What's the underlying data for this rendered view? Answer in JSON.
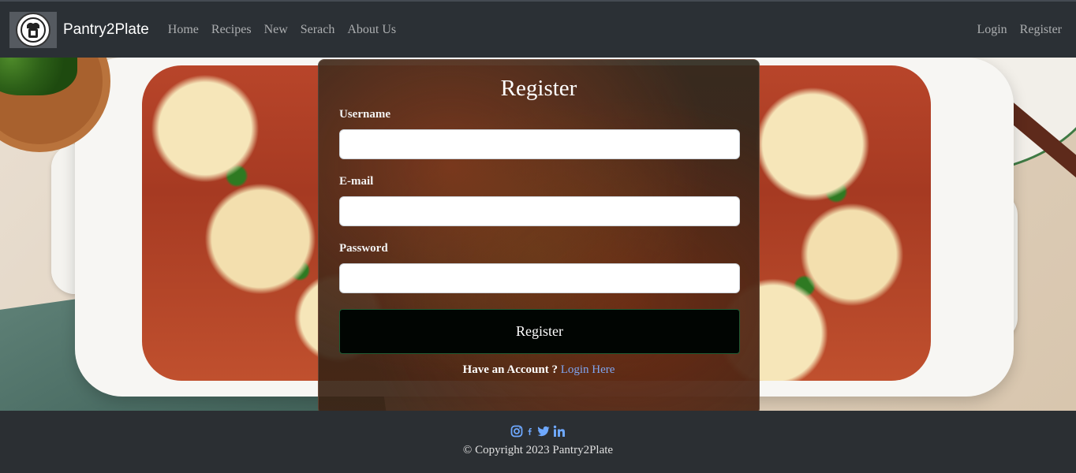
{
  "brand": {
    "name": "Pantry2Plate",
    "logo_icon": "chef-logo-icon"
  },
  "nav": {
    "left": [
      "Home",
      "Recipes",
      "New",
      "Serach",
      "About Us"
    ],
    "right": [
      "Login",
      "Register"
    ]
  },
  "form": {
    "title": "Register",
    "username_label": "Username",
    "username_value": "",
    "email_label": "E-mail",
    "email_value": "",
    "password_label": "Password",
    "password_value": "",
    "submit_label": "Register",
    "account_prompt": "Have an Account ?",
    "login_link": "Login Here"
  },
  "footer": {
    "social_icons": [
      "instagram-icon",
      "facebook-icon",
      "twitter-icon",
      "linkedin-icon"
    ],
    "copyright": "© Copyright 2023 Pantry2Plate"
  },
  "colors": {
    "navbar": "#2b3035",
    "accent_link": "#7fa5f0",
    "social_icon": "#6ea8fe",
    "button": "#010502"
  }
}
